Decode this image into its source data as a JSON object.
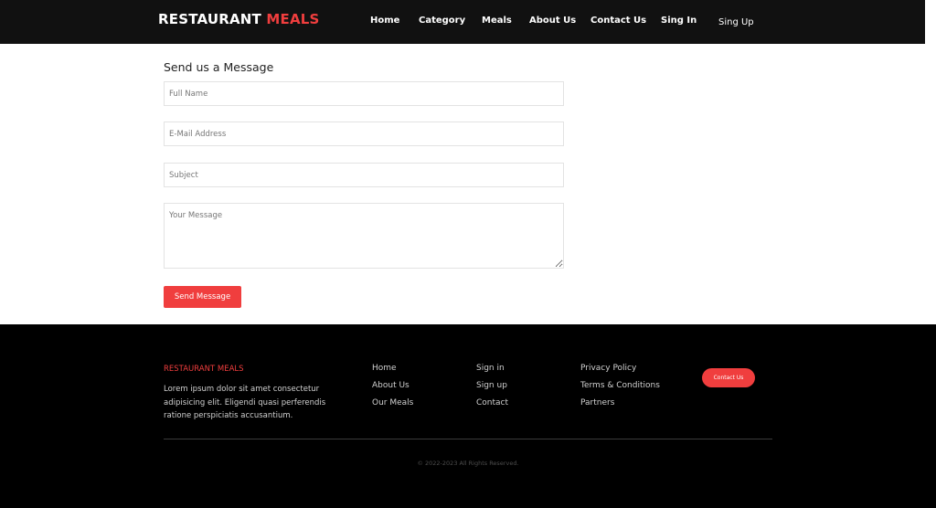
{
  "header": {
    "brand_primary": "RESTAURANT",
    "brand_accent": "MEALS",
    "nav": [
      "Home",
      "Category",
      "Meals",
      "About Us",
      "Contact Us",
      "Sing In",
      "Sing Up"
    ]
  },
  "form": {
    "title": "Send us a Message",
    "full_name_placeholder": "Full Name",
    "email_placeholder": "E-Mail Address",
    "subject_placeholder": "Subject",
    "message_placeholder": "Your Message",
    "send_label": "Send Message"
  },
  "footer": {
    "brand": "RESTAURANT MEALS",
    "description": "Lorem ipsum dolor sit amet consectetur adipisicing elit. Eligendi quasi perferendis ratione perspiciatis accusantium.",
    "col1": [
      "Home",
      "About Us",
      "Our Meals"
    ],
    "col2": [
      "Sign in",
      "Sign up",
      "Contact"
    ],
    "col3": [
      "Privacy Policy",
      "Terms & Conditions",
      "Partners"
    ],
    "contact_label": "Contact Us",
    "copyright": "© 2022-2023 All Rights Reserved."
  },
  "colors": {
    "accent": "#f03e3e",
    "header_bg": "#111111",
    "footer_bg": "#000000"
  }
}
